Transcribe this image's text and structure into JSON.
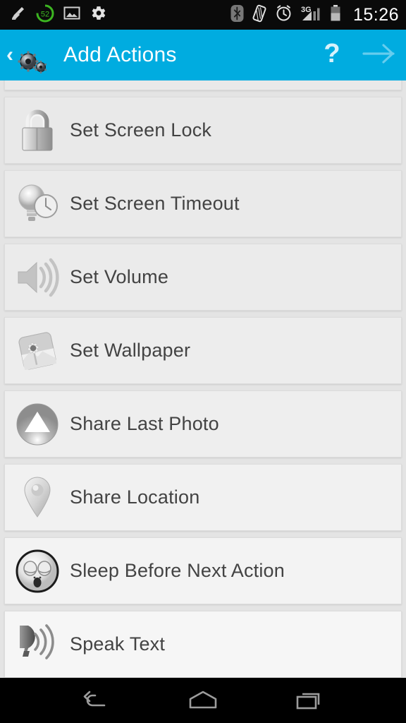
{
  "status_bar": {
    "time": "15:26",
    "left_icons": [
      {
        "name": "cleaner-broom-icon",
        "label": "broom"
      },
      {
        "name": "battery-percent-badge-icon",
        "label": "52"
      },
      {
        "name": "screenshot-image-icon",
        "label": "image"
      },
      {
        "name": "settings-gear-icon",
        "label": "gear"
      }
    ],
    "right_icons": [
      {
        "name": "bluetooth-icon",
        "label": "bluetooth"
      },
      {
        "name": "vibrate-icon",
        "label": "vibrate"
      },
      {
        "name": "alarm-clock-icon",
        "label": "alarm"
      },
      {
        "name": "signal-3g-icon",
        "label": "3G"
      },
      {
        "name": "battery-icon",
        "label": "battery"
      }
    ],
    "signal_label": "3G",
    "badge_value": "52",
    "background": "#0a0a0a"
  },
  "action_bar": {
    "back_glyph": "‹",
    "app_icon": "gears-icon",
    "title": "Add Actions",
    "help_label": "?",
    "next_icon": "arrow-right-icon",
    "background": "#00ace0",
    "title_color": "#ffffff"
  },
  "list": {
    "partial_top_item": true,
    "items": [
      {
        "label": "Set Screen Lock",
        "icon": "padlock-icon"
      },
      {
        "label": "Set Screen Timeout",
        "icon": "lightbulb-clock-icon"
      },
      {
        "label": "Set Volume",
        "icon": "speaker-volume-icon"
      },
      {
        "label": "Set Wallpaper",
        "icon": "wallpaper-photo-icon"
      },
      {
        "label": "Share Last Photo",
        "icon": "share-triangle-circle-icon"
      },
      {
        "label": "Share Location",
        "icon": "map-pin-icon"
      },
      {
        "label": "Sleep Before Next Action",
        "icon": "sleepy-face-icon"
      },
      {
        "label": "Speak Text",
        "icon": "speaking-head-icon"
      }
    ],
    "card_background_top": "#e9e9e9",
    "card_background_bottom": "#f6f6f6",
    "text_color": "#434343"
  },
  "nav_bar": {
    "buttons": [
      {
        "name": "nav-back-button",
        "label": "Back"
      },
      {
        "name": "nav-home-button",
        "label": "Home"
      },
      {
        "name": "nav-recents-button",
        "label": "Recent apps"
      }
    ],
    "background": "#000000"
  }
}
